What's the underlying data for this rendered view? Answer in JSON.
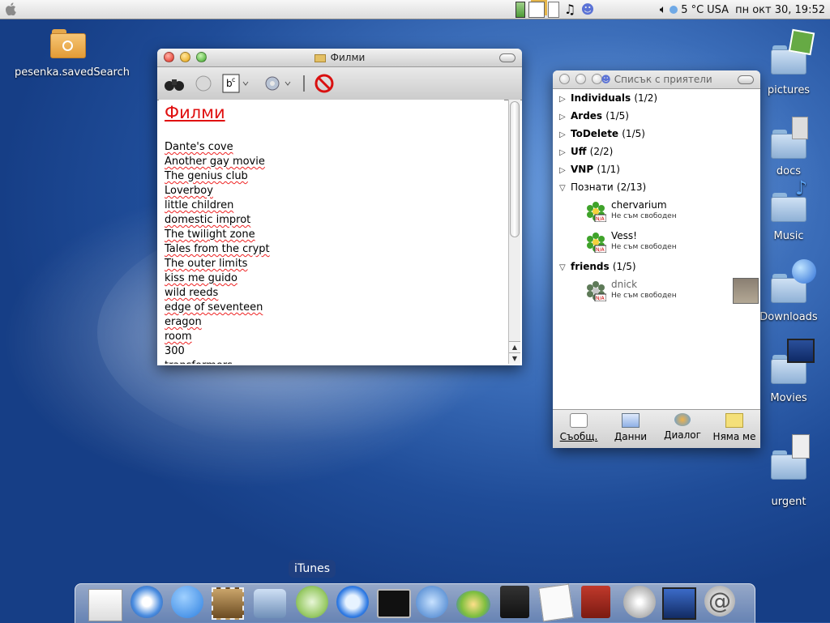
{
  "menubar": {
    "temperature": "5 °C",
    "locale": "USA",
    "datetime": "пн окт 30, 19:52"
  },
  "desktop": {
    "left_icons": [
      {
        "label": "pesenka.savedSearch",
        "icon": "saved-search-folder-icon"
      }
    ],
    "right_icons": [
      {
        "label": "pictures",
        "icon": "pictures-folder-icon"
      },
      {
        "label": "docs",
        "icon": "docs-folder-icon"
      },
      {
        "label": "Music",
        "icon": "music-folder-icon"
      },
      {
        "label": "Downloads",
        "icon": "downloads-folder-icon"
      },
      {
        "label": "Movies",
        "icon": "movies-folder-icon"
      },
      {
        "label": "urgent",
        "icon": "urgent-folder-icon"
      }
    ]
  },
  "films_window": {
    "title": "Филми",
    "heading": "Филми",
    "items": [
      "Dante's cove",
      "Another gay movie",
      "The genius club",
      "Loverboy",
      "little children",
      "domestic improt",
      "The twilight zone",
      "Tales from the crypt",
      "The outer limits",
      "kiss me guido",
      "wild reeds",
      "edge of seventeen",
      "eragon",
      "room",
      "300",
      "transformers"
    ]
  },
  "buddy_window": {
    "title": "Списък с приятели",
    "groups": [
      {
        "name": "Individuals",
        "count": "(1/2)"
      },
      {
        "name": "Ardes",
        "count": "(1/5)"
      },
      {
        "name": "ToDelete",
        "count": "(1/5)"
      },
      {
        "name": "Uff",
        "count": "(2/2)"
      },
      {
        "name": "VNP",
        "count": "(1/1)"
      },
      {
        "name": "Познати",
        "count": "(2/13)"
      },
      {
        "name": "friends",
        "count": "(1/5)"
      }
    ],
    "contacts": [
      {
        "name": "chervarium",
        "status": "Не съм свободен"
      },
      {
        "name": "Vess!",
        "status": "Не съм свободен"
      },
      {
        "name": "dnick",
        "status": "Не съм свободен"
      }
    ],
    "na_badge": "N/A",
    "buttons": [
      "Съобщ.",
      "Данни",
      "Диалог",
      "Нямa ме"
    ]
  },
  "dock": {
    "tooltip": "iTunes",
    "items": [
      "newspaper-icon",
      "safari-icon",
      "ichat-icon",
      "mail-stamp-icon",
      "iphoto-icon",
      "itunes-icon",
      "quicktime-icon",
      "terminal-icon",
      "preview-icon",
      "disk-utility-icon",
      "notebook-icon",
      "textedit-icon",
      "dictionary-icon",
      "cd-icon",
      "imovie-icon",
      "mail-icon"
    ]
  },
  "colors": {
    "heading_red": "#e01010",
    "desktop_blue": "#2a5aa8"
  }
}
